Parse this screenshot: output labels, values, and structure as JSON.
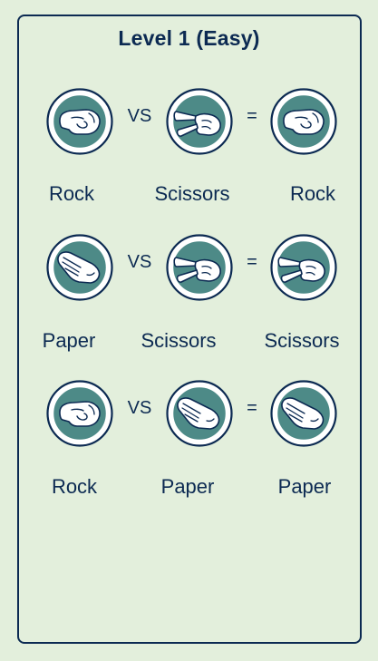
{
  "level": {
    "title": "Level 1 (Easy)"
  },
  "operators": {
    "versus": "VS",
    "equals": "="
  },
  "colors": {
    "background": "#e3efdc",
    "accent": "#4d8a87",
    "text": "#0c2a52"
  },
  "rows": [
    {
      "left": {
        "label": "Rock",
        "icon": "rock-icon"
      },
      "right": {
        "label": "Scissors",
        "icon": "scissors-icon"
      },
      "result": {
        "label": "Rock",
        "icon": "rock-icon"
      }
    },
    {
      "left": {
        "label": "Paper",
        "icon": "paper-icon"
      },
      "right": {
        "label": "Scissors",
        "icon": "scissors-icon"
      },
      "result": {
        "label": "Scissors",
        "icon": "scissors-icon"
      }
    },
    {
      "left": {
        "label": "Rock",
        "icon": "rock-icon"
      },
      "right": {
        "label": "Paper",
        "icon": "paper-icon"
      },
      "result": {
        "label": "Paper",
        "icon": "paper-icon"
      }
    }
  ]
}
